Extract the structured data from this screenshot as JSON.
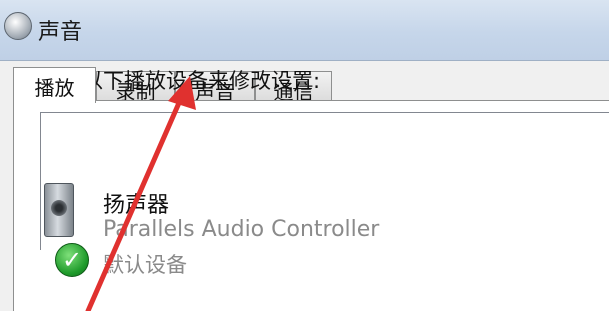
{
  "window": {
    "title": "声音",
    "icon": "speaker-icon"
  },
  "tabs": [
    {
      "label": "播放",
      "active": true
    },
    {
      "label": "录制",
      "active": false
    },
    {
      "label": "声音",
      "active": false
    },
    {
      "label": "通信",
      "active": false
    }
  ],
  "playback": {
    "instruction": "选择以下播放设备来修改设置:",
    "devices": [
      {
        "name": "扬声器",
        "description": "Parallels Audio Controller",
        "status": "默认设备",
        "icon": "speaker-icon",
        "badge_icon": "green-check-icon"
      }
    ]
  },
  "annotation": {
    "arrow_color": "#e0312f",
    "arrow_icon": "red-arrow-icon"
  },
  "colors": {
    "check_green": "#1e9a2a",
    "disabled_text": "#8a8a8a"
  }
}
